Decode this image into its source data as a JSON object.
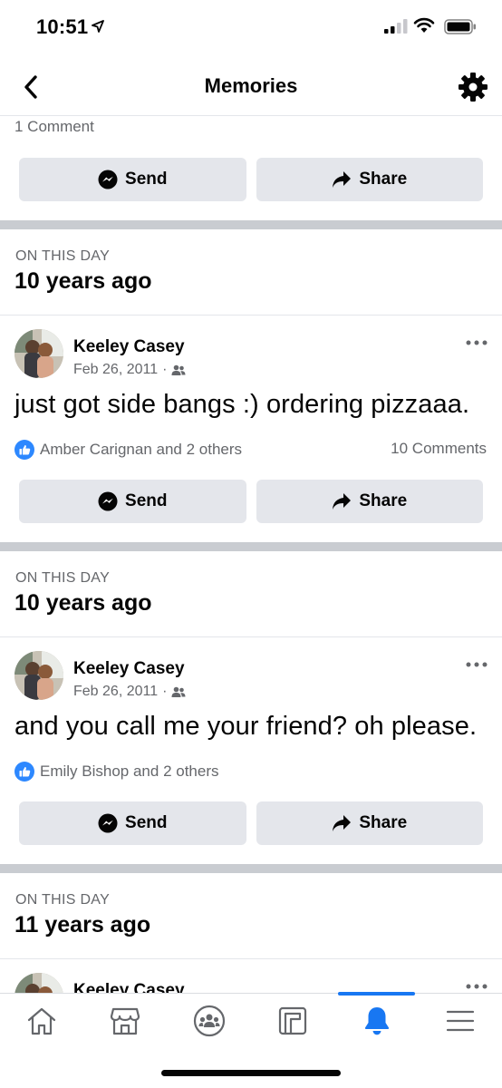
{
  "status_bar": {
    "time": "10:51"
  },
  "nav": {
    "title": "Memories"
  },
  "top_partial": {
    "comment_count": "1 Comment"
  },
  "actions": {
    "send_label": "Send",
    "share_label": "Share"
  },
  "memories": [
    {
      "on_this_day": "ON THIS DAY",
      "years_ago": "10 years ago",
      "author": "Keeley Casey",
      "date": "Feb 26, 2011",
      "separator": "·",
      "text": "just got side bangs :) ordering pizzaaa.",
      "reactions": "Amber Carignan and 2 others",
      "comments": "10 Comments"
    },
    {
      "on_this_day": "ON THIS DAY",
      "years_ago": "10 years ago",
      "author": "Keeley Casey",
      "date": "Feb 26, 2011",
      "separator": "·",
      "text": "and you call me your friend? oh please.",
      "reactions": "Emily Bishop and 2 others",
      "comments": ""
    },
    {
      "on_this_day": "ON THIS DAY",
      "years_ago": "11 years ago",
      "author": "Keeley Casey"
    }
  ],
  "tab_bar": {
    "tabs": [
      {
        "icon": "home-icon"
      },
      {
        "icon": "marketplace-icon"
      },
      {
        "icon": "groups-icon"
      },
      {
        "icon": "feeds-icon"
      },
      {
        "icon": "notifications-bell-icon",
        "active": true
      },
      {
        "icon": "menu-icon"
      }
    ]
  },
  "colors": {
    "accent": "#1877f2",
    "like_badge": "#2d88ff",
    "button_bg": "#e4e6eb",
    "divider": "#c9ccd1",
    "secondary_text": "#65676b"
  }
}
